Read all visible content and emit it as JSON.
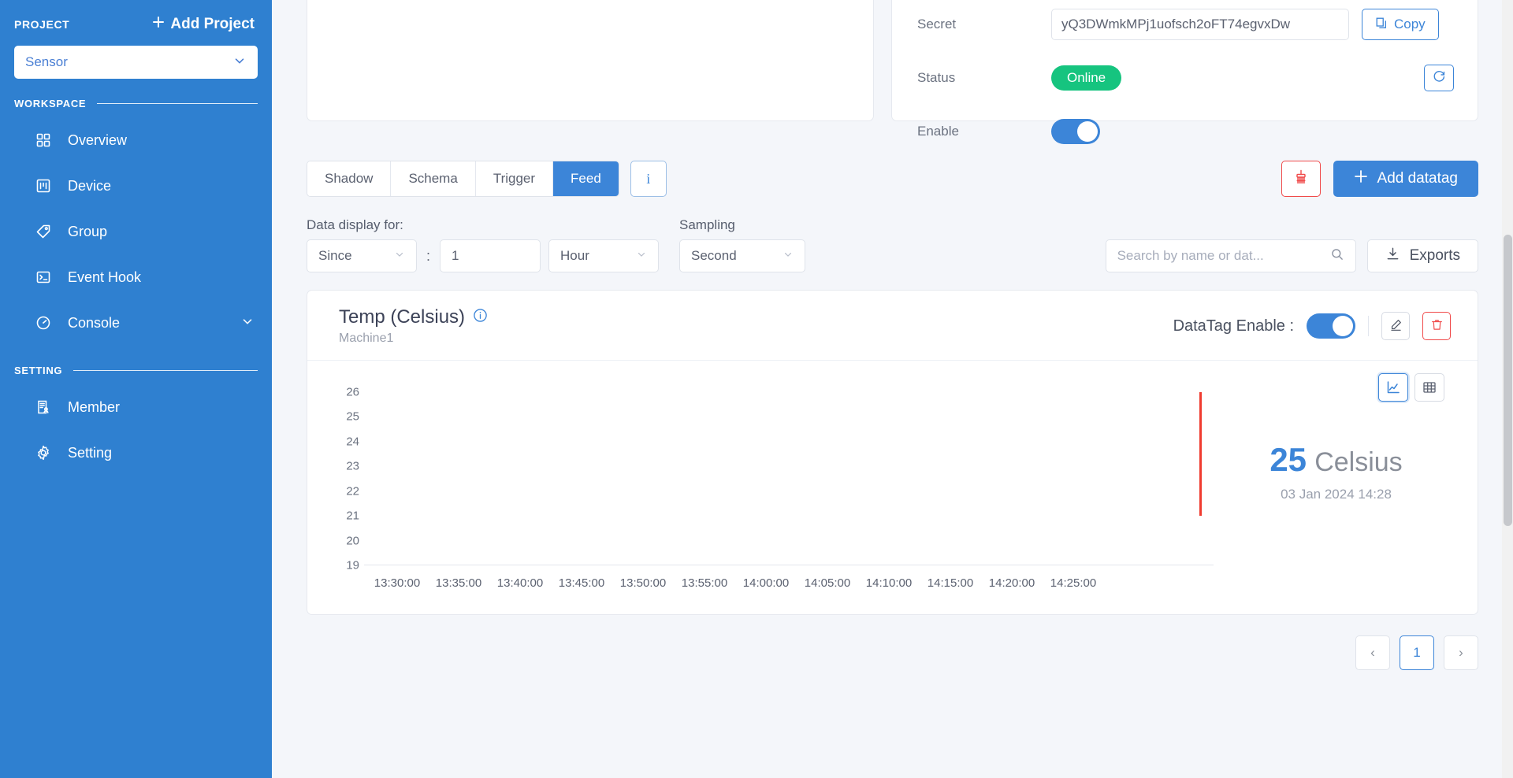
{
  "sidebar": {
    "project_label": "PROJECT",
    "add_project_label": "Add Project",
    "add_project_icon": "plus-icon",
    "project_selected": "Sensor",
    "project_caret_icon": "chevron-down-icon",
    "sections": [
      {
        "label": "WORKSPACE"
      },
      {
        "label": "SETTING"
      }
    ],
    "workspace_items": [
      {
        "label": "Overview",
        "icon": "grid-icon"
      },
      {
        "label": "Device",
        "icon": "device-icon"
      },
      {
        "label": "Group",
        "icon": "tag-icon"
      },
      {
        "label": "Event Hook",
        "icon": "terminal-icon"
      },
      {
        "label": "Console",
        "icon": "gauge-icon",
        "expandable": true,
        "caret_icon": "chevron-down-icon"
      }
    ],
    "setting_items": [
      {
        "label": "Member",
        "icon": "member-icon"
      },
      {
        "label": "Setting",
        "icon": "gear-icon"
      }
    ]
  },
  "device_panel": {
    "rows": [
      {
        "key": "Secret",
        "value": "yQ3DWmkMPj1uofsch2oFT74egvxDw"
      },
      {
        "key": "Status",
        "value": "Online"
      },
      {
        "key": "Enable",
        "value": "on"
      }
    ],
    "copy_label": "Copy",
    "copy_icon": "copy-icon",
    "refresh_icon": "refresh-icon",
    "status_color": "#16c47f",
    "accent_color": "#3c85d8"
  },
  "tabs": [
    {
      "label": "Shadow",
      "active": false
    },
    {
      "label": "Schema",
      "active": false
    },
    {
      "label": "Trigger",
      "active": false
    },
    {
      "label": "Feed",
      "active": true
    }
  ],
  "tab_info_label": "i",
  "toolbar": {
    "clear_icon": "broom-icon",
    "add_datatag_label": "Add datatag",
    "add_icon": "plus-icon"
  },
  "filters": {
    "data_display_label": "Data display for:",
    "sampling_label": "Sampling",
    "since_value": "Since",
    "amount_value": "1",
    "unit_value": "Hour",
    "sampling_value": "Second",
    "colon": ":",
    "search_placeholder": "Search by name or dat...",
    "search_icon": "search-icon",
    "exports_label": "Exports",
    "exports_icon": "download-icon"
  },
  "datatag": {
    "title": "Temp (Celsius)",
    "info_icon": "info-icon",
    "subtitle": "Machine1",
    "enable_label": "DataTag Enable :",
    "enable_state": "on",
    "edit_icon": "pencil-icon",
    "delete_icon": "trash-icon",
    "view_line_icon": "line-chart-icon",
    "view_table_icon": "table-icon",
    "latest_value": "25",
    "latest_unit": "Celsius",
    "latest_timestamp": "03 Jan 2024 14:28"
  },
  "pagination": {
    "prev_label": "‹",
    "next_label": "›",
    "pages": [
      "1"
    ],
    "current": "1"
  },
  "chart_data": {
    "type": "line",
    "title": "Temp (Celsius)",
    "xlabel": "",
    "ylabel": "",
    "grid": false,
    "legend": "none",
    "ylim": [
      19,
      26
    ],
    "yticks": [
      26,
      25,
      24,
      23,
      22,
      21,
      20,
      19
    ],
    "xticks": [
      "13:30:00",
      "13:35:00",
      "13:40:00",
      "13:45:00",
      "13:50:00",
      "13:55:00",
      "14:00:00",
      "14:05:00",
      "14:10:00",
      "14:15:00",
      "14:20:00",
      "14:25:00"
    ],
    "series": [
      {
        "name": "Temp (Celsius)",
        "color": "#f03b2f",
        "x": [
          "14:28:00"
        ],
        "values": [
          25
        ]
      }
    ],
    "note": "Single vertical red data segment near the right edge spanning approximately 21-26 Celsius at 14:28"
  }
}
